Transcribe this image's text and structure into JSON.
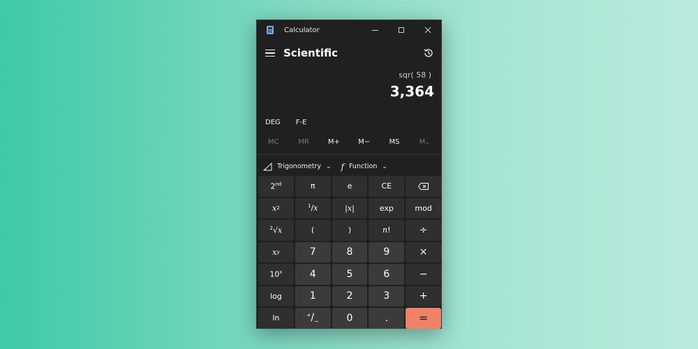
{
  "window": {
    "title": "Calculator"
  },
  "header": {
    "mode": "Scientific"
  },
  "display": {
    "expression": "sqr( 58 )",
    "result": "3,364"
  },
  "angle": {
    "unit": "DEG",
    "notation": "F-E"
  },
  "memory": [
    {
      "label": "MC",
      "enabled": false
    },
    {
      "label": "MR",
      "enabled": false
    },
    {
      "label": "M+",
      "enabled": true
    },
    {
      "label": "M−",
      "enabled": true
    },
    {
      "label": "MS",
      "enabled": true
    },
    {
      "label": "M",
      "enabled": false
    }
  ],
  "dropdowns": {
    "trig": "Trigonometry",
    "func": "Function"
  },
  "keys": {
    "pi": "π",
    "e": "e",
    "ce": "CE",
    "exp": "exp",
    "mod": "mod",
    "lparen": "(",
    "rparen": ")",
    "divide": "÷",
    "seven": "7",
    "eight": "8",
    "nine": "9",
    "multiply": "×",
    "four": "4",
    "five": "5",
    "six": "6",
    "minus": "−",
    "log": "log",
    "one": "1",
    "two": "2",
    "three": "3",
    "plus": "+",
    "ln": "ln",
    "zero": "0",
    "decimal": ".",
    "equals": "="
  },
  "colors": {
    "accent": "#f08166",
    "window_bg": "#202020",
    "key_bg": "#3b3b3b"
  }
}
